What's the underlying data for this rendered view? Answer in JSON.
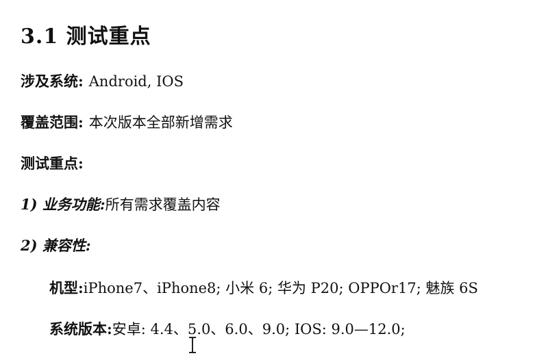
{
  "heading": "3.1 测试重点",
  "systems": {
    "label": "涉及系统:",
    "value": "Android, IOS"
  },
  "coverage": {
    "label": "覆盖范围:",
    "value": "本次版本全部新增需求"
  },
  "focus": {
    "label": "测试重点:"
  },
  "item1": {
    "label": "1) 业务功能:",
    "value": "所有需求覆盖内容"
  },
  "item2": {
    "label": "2) 兼容性:"
  },
  "models": {
    "label": "机型:",
    "value": "iPhone7、iPhone8; 小米 6; 华为 P20; OPPOr17; 魅族 6S"
  },
  "versions": {
    "label": "系统版本:",
    "value": "安卓: 4.4、5.0、6.0、9.0; IOS: 9.0—12.0;"
  }
}
